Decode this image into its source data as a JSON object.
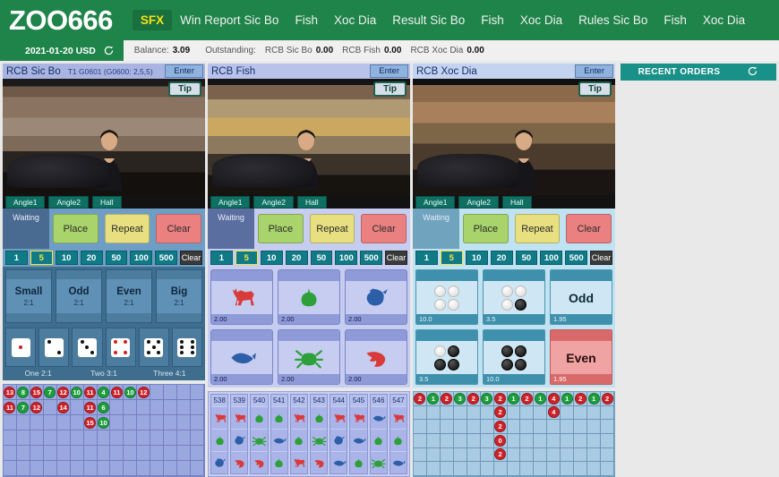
{
  "brand": "ZOO666",
  "nav": [
    {
      "label": "SFX",
      "active": true
    },
    {
      "label": "Win Report Sic Bo",
      "active": false
    },
    {
      "label": "Fish",
      "active": false
    },
    {
      "label": "Xoc Dia",
      "active": false
    },
    {
      "label": "Result Sic Bo",
      "active": false
    },
    {
      "label": "Fish",
      "active": false
    },
    {
      "label": "Xoc Dia",
      "active": false
    },
    {
      "label": "Rules Sic Bo",
      "active": false
    },
    {
      "label": "Fish",
      "active": false
    },
    {
      "label": "Xoc Dia",
      "active": false
    }
  ],
  "info": {
    "date": "2021-01-20 USD",
    "refresh_icon": "refresh-icon",
    "balance_label": "Balance:",
    "balance_value": "3.09",
    "outstanding_label": "Outstanding:",
    "outstanding": [
      {
        "label": "RCB Sic Bo",
        "value": "0.00"
      },
      {
        "label": "RCB Fish",
        "value": "0.00"
      },
      {
        "label": "RCB Xoc Dia",
        "value": "0.00"
      }
    ]
  },
  "common": {
    "enter": "Enter",
    "tip": "Tip",
    "status": "Waiting",
    "angles": [
      "Angle1",
      "Angle2",
      "Hall"
    ],
    "actions": {
      "place": "Place",
      "repeat": "Repeat",
      "clear": "Clear"
    },
    "chips": [
      "1",
      "5",
      "10",
      "20",
      "50",
      "100",
      "500"
    ],
    "chip_clear": "Clear",
    "chip_selected": "5"
  },
  "panels": [
    {
      "title": "RCB Sic Bo",
      "subtitle": "T1 G0601 (G0600: 2,5,5)",
      "bets": [
        {
          "name": "Small",
          "odds": "2:1"
        },
        {
          "name": "Odd",
          "odds": "2:1"
        },
        {
          "name": "Even",
          "odds": "2:1"
        },
        {
          "name": "Big",
          "odds": "2:1"
        }
      ],
      "dice": [
        1,
        2,
        3,
        4,
        5,
        6
      ],
      "dice_labels": [
        "One 2:1",
        "Two 3:1",
        "Three 4:1"
      ],
      "road": {
        "cols": 15,
        "rows": 6,
        "beads": [
          {
            "c": 0,
            "r": 0,
            "v": "13",
            "color": "r"
          },
          {
            "c": 1,
            "r": 0,
            "v": "8",
            "color": "g"
          },
          {
            "c": 2,
            "r": 0,
            "v": "15",
            "color": "r"
          },
          {
            "c": 3,
            "r": 0,
            "v": "7",
            "color": "g"
          },
          {
            "c": 4,
            "r": 0,
            "v": "12",
            "color": "r"
          },
          {
            "c": 5,
            "r": 0,
            "v": "10",
            "color": "g"
          },
          {
            "c": 6,
            "r": 0,
            "v": "11",
            "color": "r"
          },
          {
            "c": 7,
            "r": 0,
            "v": "4",
            "color": "g"
          },
          {
            "c": 8,
            "r": 0,
            "v": "11",
            "color": "r"
          },
          {
            "c": 9,
            "r": 0,
            "v": "10",
            "color": "g"
          },
          {
            "c": 10,
            "r": 0,
            "v": "12",
            "color": "r"
          },
          {
            "c": 0,
            "r": 1,
            "v": "11",
            "color": "r"
          },
          {
            "c": 1,
            "r": 1,
            "v": "7",
            "color": "g"
          },
          {
            "c": 2,
            "r": 1,
            "v": "12",
            "color": "r"
          },
          {
            "c": 4,
            "r": 1,
            "v": "14",
            "color": "r"
          },
          {
            "c": 6,
            "r": 1,
            "v": "11",
            "color": "r"
          },
          {
            "c": 7,
            "r": 1,
            "v": "6",
            "color": "g"
          },
          {
            "c": 6,
            "r": 2,
            "v": "15",
            "color": "r"
          },
          {
            "c": 7,
            "r": 2,
            "v": "10",
            "color": "g"
          }
        ]
      }
    },
    {
      "title": "RCB Fish",
      "subtitle": "",
      "tiles": [
        {
          "animal": "deer",
          "color": "#d93a3a",
          "odds": "2.00"
        },
        {
          "animal": "gourd",
          "color": "#2ea03a",
          "odds": "2.00"
        },
        {
          "animal": "rooster",
          "color": "#2c5fa8",
          "odds": "2.00"
        },
        {
          "animal": "fish",
          "color": "#2c5fa8",
          "odds": "2.00"
        },
        {
          "animal": "crab",
          "color": "#2ea03a",
          "odds": "2.00"
        },
        {
          "animal": "shrimp",
          "color": "#d93a3a",
          "odds": "2.00"
        }
      ],
      "road": {
        "columns": [
          {
            "id": "538",
            "results": [
              "deer",
              "gourd",
              "rooster"
            ]
          },
          {
            "id": "539",
            "results": [
              "deer",
              "rooster",
              "shrimp"
            ]
          },
          {
            "id": "540",
            "results": [
              "gourd",
              "crab",
              "shrimp"
            ]
          },
          {
            "id": "541",
            "results": [
              "gourd",
              "fish",
              "gourd"
            ]
          },
          {
            "id": "542",
            "results": [
              "deer",
              "gourd",
              "deer"
            ]
          },
          {
            "id": "543",
            "results": [
              "gourd",
              "crab",
              "shrimp"
            ]
          },
          {
            "id": "544",
            "results": [
              "deer",
              "rooster",
              "fish"
            ]
          },
          {
            "id": "545",
            "results": [
              "deer",
              "fish",
              "gourd"
            ]
          },
          {
            "id": "546",
            "results": [
              "fish",
              "gourd",
              "crab"
            ]
          },
          {
            "id": "547",
            "results": [
              "deer",
              "gourd",
              "fish"
            ]
          }
        ]
      }
    },
    {
      "title": "RCB Xoc Dia",
      "subtitle": "",
      "tiles": [
        {
          "kind": "coins",
          "coins": [
            "w",
            "w",
            "w",
            "w"
          ],
          "odds": "10.0",
          "label": ""
        },
        {
          "kind": "coins",
          "coins": [
            "w",
            "w",
            "w",
            "b"
          ],
          "odds": "3.5",
          "label": ""
        },
        {
          "kind": "word",
          "label": "Odd",
          "odds": "1.95",
          "selected": false
        },
        {
          "kind": "coins",
          "coins": [
            "w",
            "b",
            "b",
            "b"
          ],
          "odds": "3.5",
          "label": ""
        },
        {
          "kind": "coins",
          "coins": [
            "b",
            "b",
            "b",
            "b"
          ],
          "odds": "10.0",
          "label": ""
        },
        {
          "kind": "word",
          "label": "Even",
          "odds": "1.95",
          "selected": true
        }
      ],
      "road": {
        "cols": 15,
        "rows": 6,
        "beads": [
          {
            "c": 0,
            "r": 0,
            "v": "2",
            "color": "r"
          },
          {
            "c": 1,
            "r": 0,
            "v": "1",
            "color": "g"
          },
          {
            "c": 2,
            "r": 0,
            "v": "2",
            "color": "r"
          },
          {
            "c": 3,
            "r": 0,
            "v": "3",
            "color": "g"
          },
          {
            "c": 4,
            "r": 0,
            "v": "2",
            "color": "r"
          },
          {
            "c": 5,
            "r": 0,
            "v": "3",
            "color": "g"
          },
          {
            "c": 6,
            "r": 0,
            "v": "2",
            "color": "r"
          },
          {
            "c": 7,
            "r": 0,
            "v": "1",
            "color": "g"
          },
          {
            "c": 8,
            "r": 0,
            "v": "2",
            "color": "r"
          },
          {
            "c": 9,
            "r": 0,
            "v": "1",
            "color": "g"
          },
          {
            "c": 10,
            "r": 0,
            "v": "4",
            "color": "r"
          },
          {
            "c": 11,
            "r": 0,
            "v": "1",
            "color": "g"
          },
          {
            "c": 12,
            "r": 0,
            "v": "2",
            "color": "r"
          },
          {
            "c": 13,
            "r": 0,
            "v": "1",
            "color": "g"
          },
          {
            "c": 14,
            "r": 0,
            "v": "2",
            "color": "r"
          },
          {
            "c": 6,
            "r": 1,
            "v": "2",
            "color": "r"
          },
          {
            "c": 10,
            "r": 1,
            "v": "4",
            "color": "r"
          },
          {
            "c": 6,
            "r": 2,
            "v": "2",
            "color": "r"
          },
          {
            "c": 6,
            "r": 3,
            "v": "0",
            "color": "r"
          },
          {
            "c": 6,
            "r": 4,
            "v": "2",
            "color": "r"
          }
        ]
      }
    }
  ],
  "sidebar": {
    "title": "RECENT ORDERS",
    "refresh_icon": "refresh-icon"
  }
}
